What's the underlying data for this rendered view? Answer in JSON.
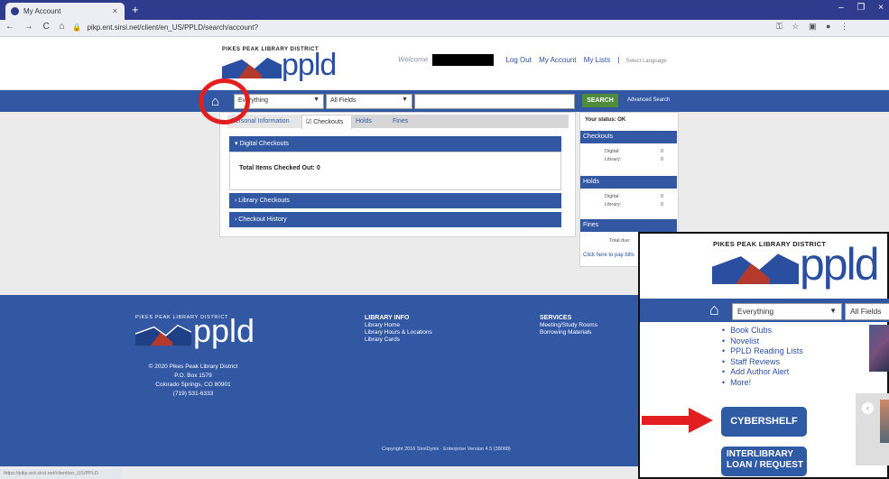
{
  "browser": {
    "tab_title": "My Account",
    "tab_close": "×",
    "new_tab": "+",
    "url": "pikp.ent.sirsi.net/client/en_US/PPLD/search/account?",
    "window_controls": [
      "–",
      "❐",
      "×"
    ],
    "nav": [
      "←",
      "→",
      "C",
      "⌂"
    ],
    "lock": "🔒"
  },
  "header": {
    "district_label": "PIKES PEAK LIBRARY DISTRICT",
    "ppld_logo": "ppld",
    "welcome": "Welcome",
    "logout": "Log Out",
    "my_account": "My Account",
    "my_lists": "My Lists",
    "divider": "|",
    "language": "Select Language"
  },
  "search": {
    "home_glyph": "⌂",
    "type_value": "Everything",
    "field_value": "All Fields",
    "arrow": "▼",
    "button": "SEARCH",
    "advanced": "Advanced Search"
  },
  "account_tabs": {
    "personal": "Personal Information",
    "checkouts": "☑ Checkouts",
    "holds": "Holds",
    "fines": "Fines"
  },
  "sections": {
    "digital": "▾  Digital Checkouts",
    "total": "Total Items Checked Out: 0",
    "library": "›  Library Checkouts",
    "history": "›  Checkout History"
  },
  "sidebar": {
    "status": "Your status: OK",
    "checkouts_head": "Checkouts",
    "holds_head": "Holds",
    "fines_head": "Fines",
    "digital_label": "Digital:",
    "library_label": "Library:",
    "checkouts_digital": "0",
    "checkouts_library": "0",
    "holds_digital": "0",
    "holds_library": "0",
    "total_due_label": "Total due:",
    "pay_fines": "Click here to pay bills"
  },
  "footer": {
    "district_label": "PIKES PEAK LIBRARY DISTRICT",
    "ppld_logo": "ppld",
    "address_lines": [
      "© 2020 Pikes Peak Library District",
      "P.O. Box 1579",
      "Colorado Springs, CO 80901",
      "(719) 531-6333"
    ],
    "info_heading": "LIBRARY INFO",
    "info_links": [
      "Library Home",
      "Library Hours & Locations",
      "Library Cards"
    ],
    "services_heading": "SERVICES",
    "services_links": [
      "Meeting/Study Rooms",
      "Borrowing Materials"
    ],
    "copyright": "Copyright 2016 SirsiDynix · Enterprise Version 4.5 (38068)"
  },
  "statusbar": "https://pikp.ent.sirsi.net/client/en_US/PPLD",
  "inset": {
    "district_label": "PIKES PEAK LIBRARY DISTRICT",
    "ppld_logo": "ppld",
    "home_glyph": "⌂",
    "type_value": "Everything",
    "field_value": "All Fields",
    "arrow": "▼",
    "list": [
      "Book Clubs",
      "Novelist",
      "PPLD Reading Lists",
      "Staff Reviews",
      "Add Author Alert",
      "More!"
    ],
    "cybershelf": "CYBERSHELF",
    "ill_line1": "INTERLIBRARY",
    "ill_line2": "LOAN / REQUEST",
    "carousel_arrow": "‹"
  },
  "colors": {
    "brand_blue": "#3258a4",
    "search_green": "#4e8b3a",
    "annotation_red": "#e31e1e"
  }
}
